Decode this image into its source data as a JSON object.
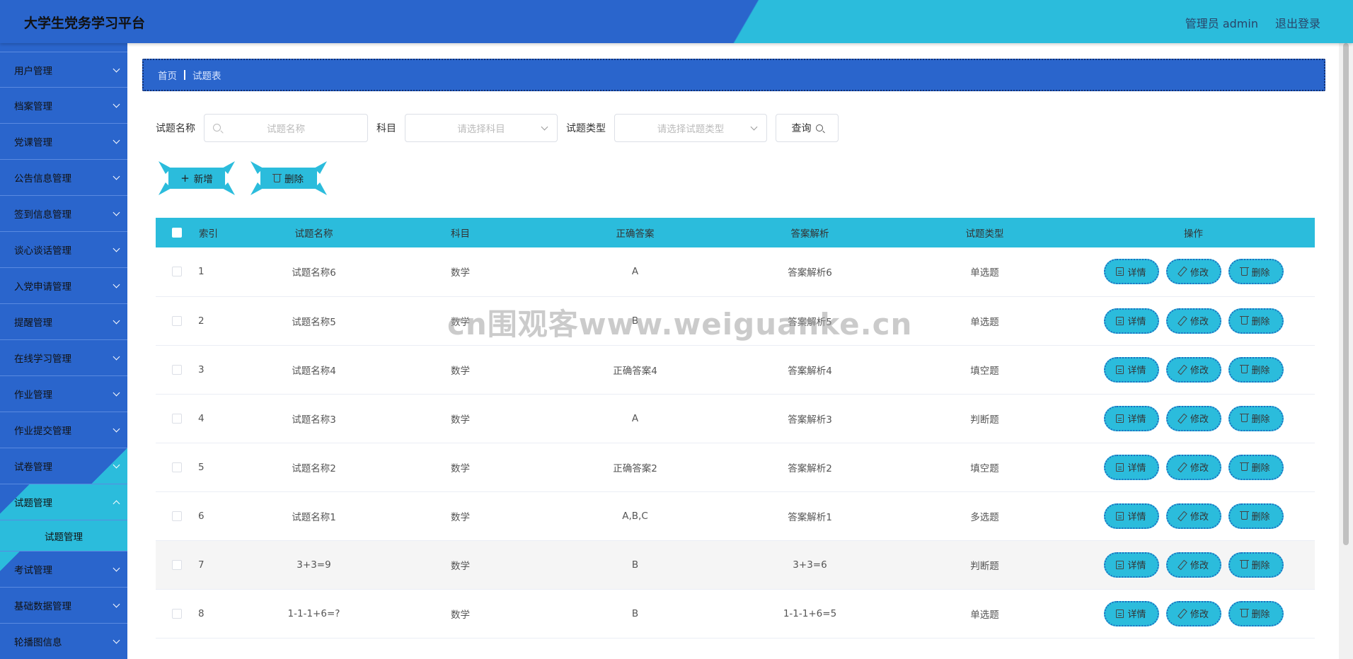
{
  "header": {
    "title": "大学生党务学习平台",
    "user": "管理员 admin",
    "logout": "退出登录"
  },
  "sidebar": {
    "items": [
      {
        "label": "用户管理"
      },
      {
        "label": "档案管理"
      },
      {
        "label": "党课管理"
      },
      {
        "label": "公告信息管理"
      },
      {
        "label": "签到信息管理"
      },
      {
        "label": "谈心谈话管理"
      },
      {
        "label": "入党申请管理"
      },
      {
        "label": "提醒管理"
      },
      {
        "label": "在线学习管理"
      },
      {
        "label": "作业管理"
      },
      {
        "label": "作业提交管理"
      },
      {
        "label": "试卷管理"
      },
      {
        "label": "试题管理"
      },
      {
        "label": "考试管理"
      },
      {
        "label": "基础数据管理"
      },
      {
        "label": "轮播图信息"
      }
    ],
    "submenu_label": "试题管理"
  },
  "breadcrumb": {
    "home": "首页",
    "current": "试题表"
  },
  "filters": {
    "name_label": "试题名称",
    "name_placeholder": "试题名称",
    "subject_label": "科目",
    "subject_placeholder": "请选择科目",
    "type_label": "试题类型",
    "type_placeholder": "请选择试题类型",
    "query": "查询"
  },
  "actions": {
    "add": "新增",
    "delete": "删除"
  },
  "table": {
    "headers": [
      "索引",
      "试题名称",
      "科目",
      "正确答案",
      "答案解析",
      "试题类型",
      "操作"
    ],
    "op": {
      "detail": "详情",
      "edit": "修改",
      "delete": "删除"
    },
    "rows": [
      {
        "idx": "1",
        "name": "试题名称6",
        "subject": "数学",
        "answer": "A",
        "analysis": "答案解析6",
        "type": "单选题"
      },
      {
        "idx": "2",
        "name": "试题名称5",
        "subject": "数学",
        "answer": "B",
        "analysis": "答案解析5",
        "type": "单选题"
      },
      {
        "idx": "3",
        "name": "试题名称4",
        "subject": "数学",
        "answer": "正确答案4",
        "analysis": "答案解析4",
        "type": "填空题"
      },
      {
        "idx": "4",
        "name": "试题名称3",
        "subject": "数学",
        "answer": "A",
        "analysis": "答案解析3",
        "type": "判断题"
      },
      {
        "idx": "5",
        "name": "试题名称2",
        "subject": "数学",
        "answer": "正确答案2",
        "analysis": "答案解析2",
        "type": "填空题"
      },
      {
        "idx": "6",
        "name": "试题名称1",
        "subject": "数学",
        "answer": "A,B,C",
        "analysis": "答案解析1",
        "type": "多选题"
      },
      {
        "idx": "7",
        "name": "3+3=9",
        "subject": "数学",
        "answer": "B",
        "analysis": "3+3=6",
        "type": "判断题"
      },
      {
        "idx": "8",
        "name": "1-1-1+6=?",
        "subject": "数学",
        "answer": "B",
        "analysis": "1-1-1+6=5",
        "type": "单选题"
      }
    ]
  },
  "watermark": "cn围观客www.weiguanke.cn"
}
